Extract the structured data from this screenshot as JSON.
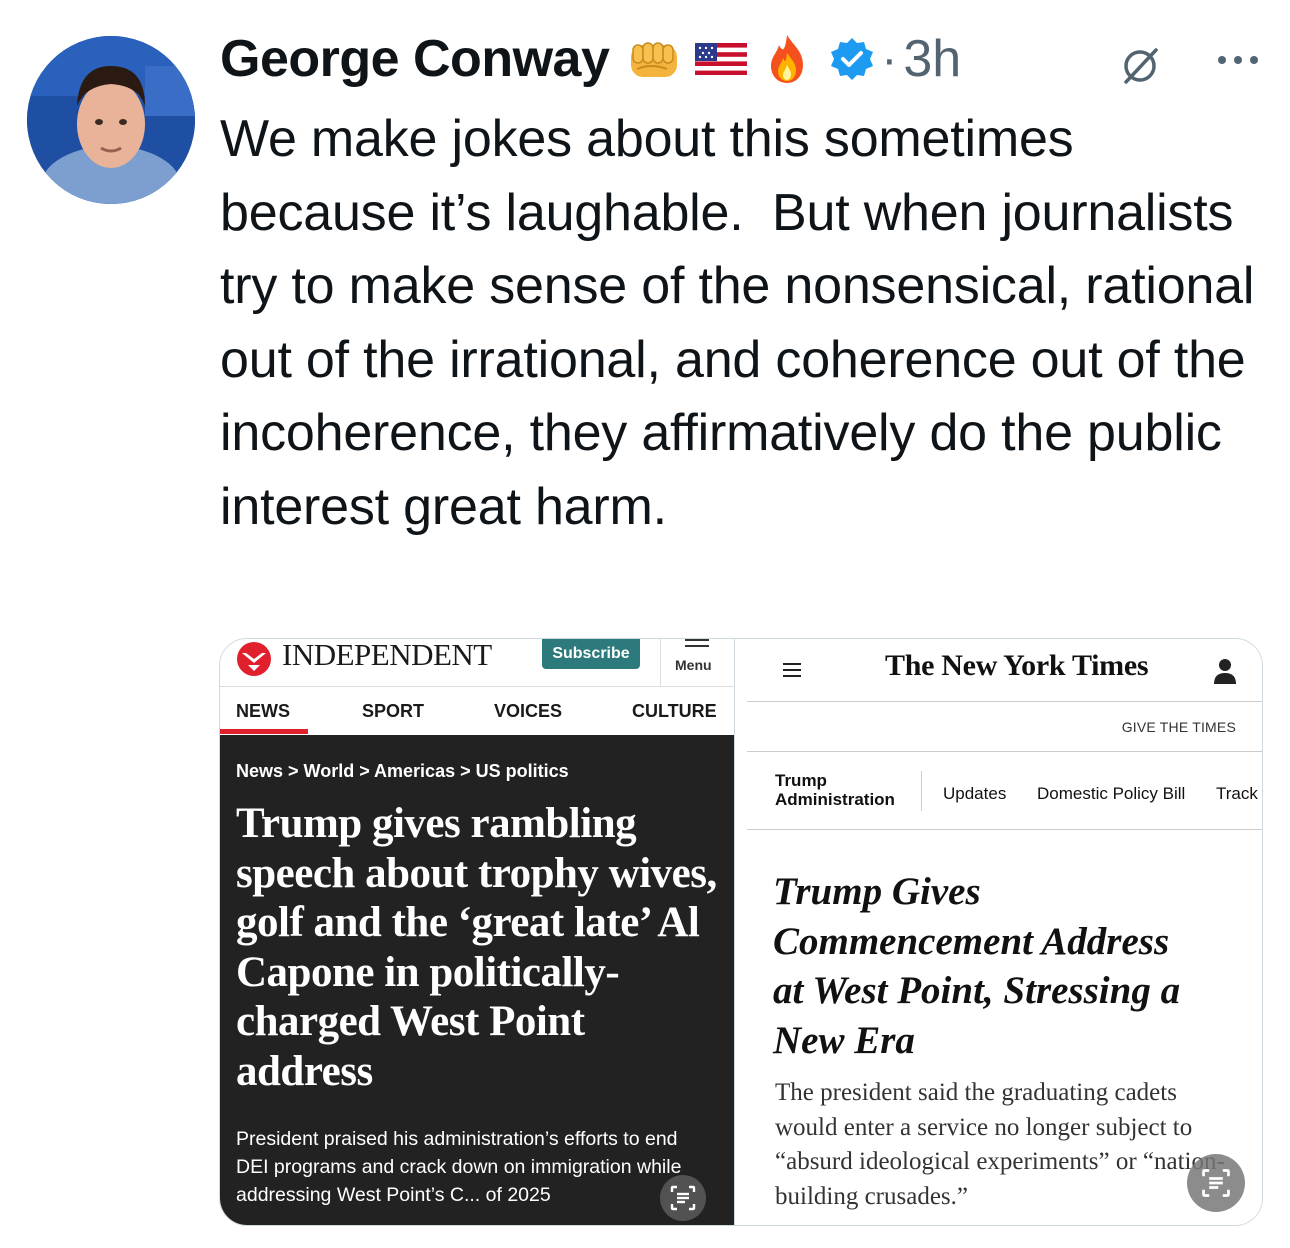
{
  "author": {
    "name": "George Conway",
    "time": "3h",
    "dot": "·"
  },
  "tweet": {
    "text": "We make jokes about this sometimes because it’s laughable.  But when journalists try to make sense of the nonsensical, rational out of the irrational, and coherence out of the incoherence, they affirmatively do the public interest great harm."
  },
  "independent": {
    "logo": "INDEPENDENT",
    "subscribe": "Subscribe",
    "menu": "Menu",
    "nav": [
      "NEWS",
      "SPORT",
      "VOICES",
      "CULTURE"
    ],
    "breadcrumb": "News > World > Americas > US politics",
    "headline": "Trump gives rambling speech about trophy wives, golf and the ‘great late’ Al Capone in politically-charged West Point address",
    "summary": "President praised his administration’s efforts to end DEI programs and crack down on immigration while addressing West Point’s C... of 2025"
  },
  "nyt": {
    "logo": "The New York Times",
    "give": "GIVE THE TIMES",
    "section_line1": "Trump",
    "section_line2": "Administration",
    "tabs": [
      "Updates",
      "Domestic Policy Bill",
      "Track"
    ],
    "headline": "Trump Gives Commencement Address at West Point, Stressing a New Era",
    "summary": "The president said the graduating cadets would enter a service no longer subject to “absurd ideological experiments” or “nation-building crusades.”"
  },
  "colors": {
    "verified": "#1d9bf0",
    "muted": "#536471",
    "independent_red": "#e0202c",
    "independent_teal": "#2c7a7b"
  }
}
